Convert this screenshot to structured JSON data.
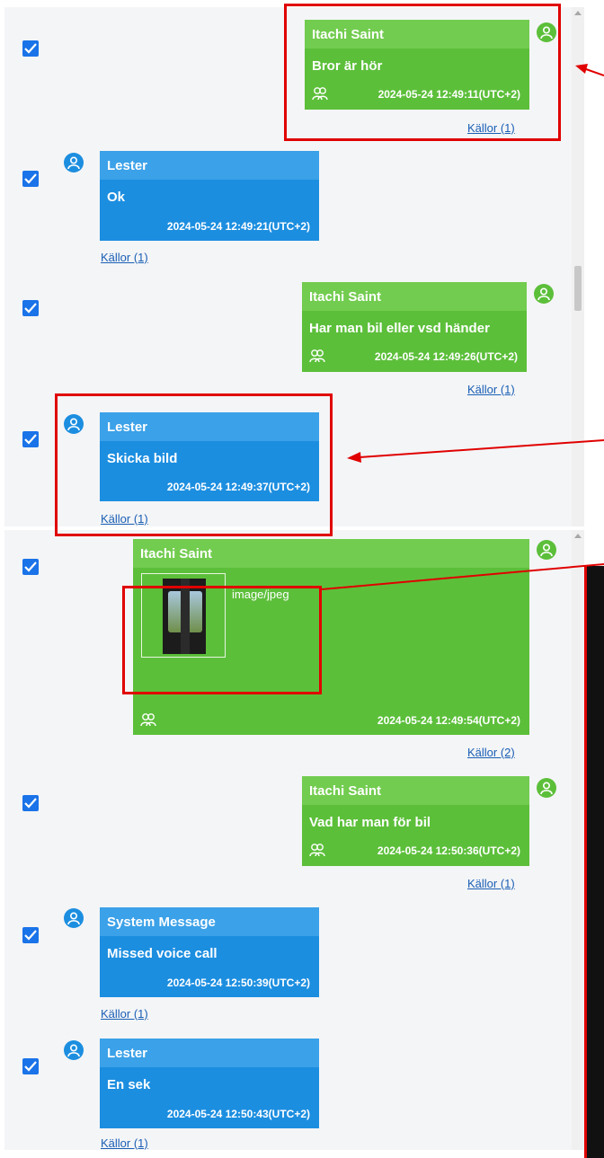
{
  "messages": [
    {
      "sender": "Itachi Saint",
      "text": "Bror är hör",
      "time": "2024-05-24 12:49:11(UTC+2)",
      "sources": "Källor (1)"
    },
    {
      "sender": "Lester",
      "text": "Ok",
      "time": "2024-05-24 12:49:21(UTC+2)",
      "sources": "Källor (1)"
    },
    {
      "sender": "Itachi Saint",
      "text": "Har man bil eller vsd händer",
      "time": "2024-05-24 12:49:26(UTC+2)",
      "sources": "Källor (1)"
    },
    {
      "sender": "Lester",
      "text": "Skicka bild",
      "time": "2024-05-24 12:49:37(UTC+2)",
      "sources": "Källor (1)"
    },
    {
      "sender": "Itachi Saint",
      "attachment_type": "image/jpeg",
      "time": "2024-05-24 12:49:54(UTC+2)",
      "sources": "Källor (2)"
    },
    {
      "sender": "Itachi Saint",
      "text": "Vad har man för bil",
      "time": "2024-05-24 12:50:36(UTC+2)",
      "sources": "Källor (1)"
    },
    {
      "sender": "System Message",
      "text": "Missed voice call",
      "time": "2024-05-24 12:50:39(UTC+2)",
      "sources": "Källor (1)"
    },
    {
      "sender": "Lester",
      "text": "En sek",
      "time": "2024-05-24 12:50:43(UTC+2)",
      "sources": "Källor (1)"
    }
  ],
  "colors": {
    "outgoing": "#5cbf3a",
    "incoming": "#1c8ee0",
    "checkbox": "#1a73e8",
    "annotation": "#e00000",
    "link": "#1a5fb4"
  },
  "icons": {
    "avatar": "user-icon",
    "group": "group-icon",
    "checkbox": "check-icon"
  }
}
